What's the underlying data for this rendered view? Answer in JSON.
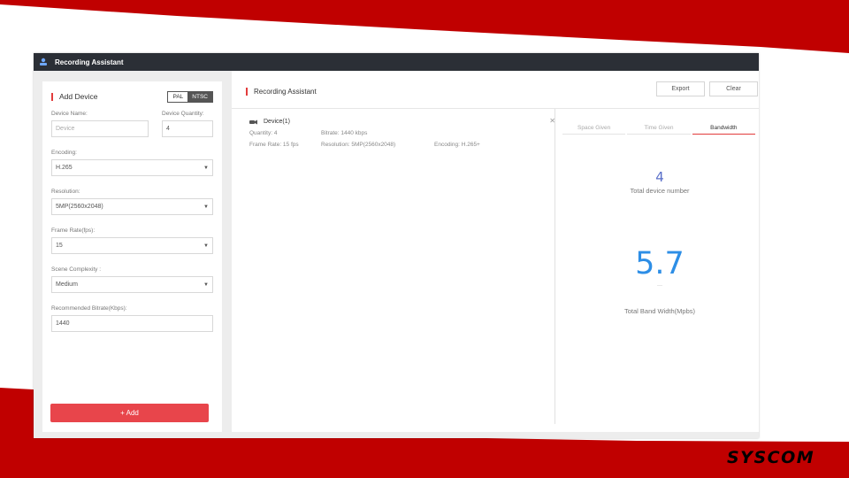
{
  "window": {
    "title": "Recording Assistant"
  },
  "add_device": {
    "section_title": "Add Device",
    "standard_options": [
      "PAL",
      "NTSC"
    ],
    "standard_selected": "NTSC",
    "device_name_label": "Device Name:",
    "device_name_value": "Device",
    "device_quantity_label": "Device Quantity:",
    "device_quantity_value": "4",
    "encoding_label": "Encoding:",
    "encoding_value": "H.265",
    "resolution_label": "Resolution:",
    "resolution_value": "5MP(2560x2048)",
    "frame_rate_label": "Frame Rate(fps):",
    "frame_rate_value": "15",
    "scene_label": "Scene Complexity :",
    "scene_value": "Medium",
    "bitrate_label": "Recommended Bitrate(Kbps):",
    "bitrate_value": "1440",
    "add_button": "+ Add"
  },
  "assistant": {
    "section_title": "Recording Assistant",
    "export_button": "Export",
    "clear_button": "Clear",
    "device": {
      "name": "Device(1)",
      "quantity": "Quantity: 4",
      "bitrate": "Bitrate: 1440 kbps",
      "frame_rate": "Frame Rate: 15 fps",
      "resolution": "Resolution: 5MP(2560x2048)",
      "encoding": "Encoding: H.265+"
    },
    "tabs": [
      "Space Given",
      "Time Given",
      "Bandwidth"
    ],
    "active_tab": "Bandwidth",
    "total_devices_value": "4",
    "total_devices_label": "Total device number",
    "bandwidth_value": "5.7",
    "bandwidth_separator": "—",
    "bandwidth_label": "Total Band Width(Mpbs)"
  },
  "branding": {
    "logo_text": "SYSCOM"
  },
  "colors": {
    "accent_red": "#e23c3c",
    "add_button": "#e8454b",
    "titlebar": "#2b2f36",
    "stat_blue": "#2d8ee6",
    "slide_red": "#c00000"
  }
}
